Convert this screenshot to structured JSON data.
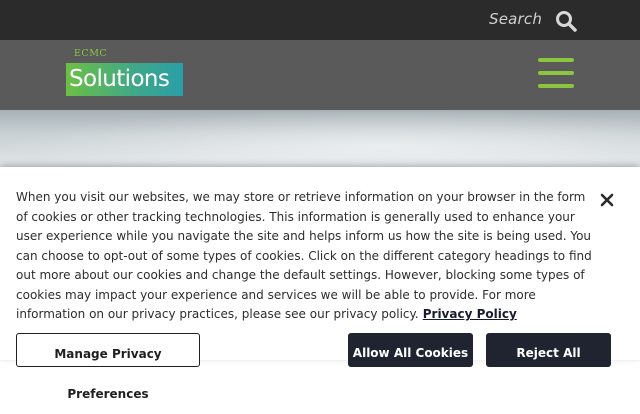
{
  "topbar": {
    "search_label": "Search",
    "search_icon": "search-icon"
  },
  "header": {
    "logo_small": "ECMC",
    "logo_main": "Solutions",
    "menu_icon": "hamburger-menu-icon",
    "brand_green": "#8cc63f"
  },
  "cookie_banner": {
    "body": "When you visit our websites, we may store or retrieve information on your browser in the form of cookies or other tracking technologies. This information is generally used to enhance your user experience while you navigate the site and helps inform us how the site is being used. You can choose to opt-out of some types of cookies. Click on the different category headings to find out more about our cookies and change the default settings. However, blocking some types of cookies may impact your experience and services we will be able to provide. For more information on our privacy practices, please see our privacy policy.",
    "policy_link": "Privacy Policy",
    "close_icon": "close-icon",
    "manage_label": "Manage Privacy Preferences",
    "allow_label": "Allow All Cookies",
    "reject_label": "Reject All"
  }
}
